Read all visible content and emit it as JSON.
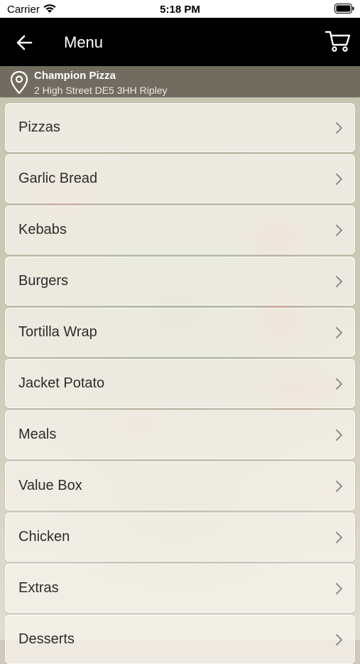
{
  "status_bar": {
    "carrier": "Carrier",
    "time": "5:18 PM"
  },
  "nav": {
    "title": "Menu",
    "back_icon": "arrow-left-icon",
    "cart_icon": "cart-icon"
  },
  "store": {
    "name": "Champion Pizza",
    "address": "2 High Street DE5 3HH Ripley",
    "icon": "map-pin-icon"
  },
  "menu": {
    "items": [
      {
        "label": "Pizzas"
      },
      {
        "label": "Garlic Bread"
      },
      {
        "label": "Kebabs"
      },
      {
        "label": "Burgers"
      },
      {
        "label": "Tortilla Wrap"
      },
      {
        "label": "Jacket Potato"
      },
      {
        "label": "Meals"
      },
      {
        "label": "Value Box"
      },
      {
        "label": "Chicken"
      },
      {
        "label": "Extras"
      },
      {
        "label": "Desserts"
      }
    ]
  },
  "colors": {
    "nav_background": "#000000",
    "location_background": "#5f584e",
    "item_background": "#f6f3ec",
    "text": "#2c2c2c"
  }
}
